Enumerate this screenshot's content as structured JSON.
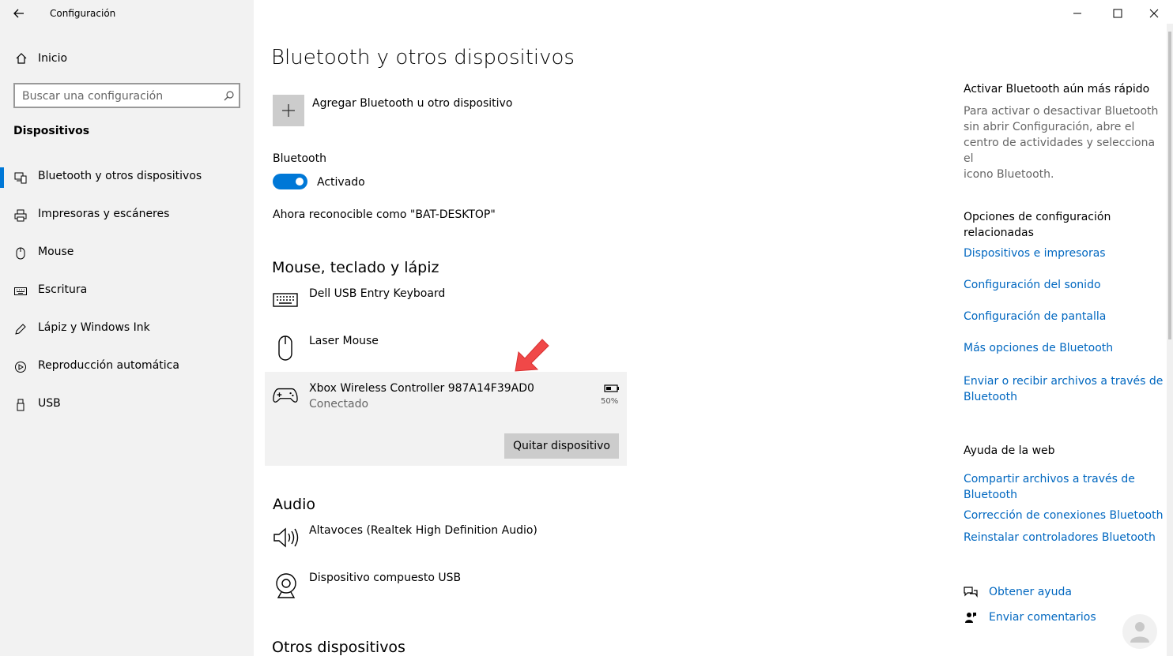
{
  "window": {
    "title": "Configuración",
    "controls": [
      "minimize-icon",
      "maximize-icon",
      "close-icon"
    ]
  },
  "sidebar": {
    "home_label": "Inicio",
    "search_placeholder": "Buscar una configuración",
    "section_title": "Dispositivos",
    "items": [
      {
        "label": "Bluetooth y otros dispositivos",
        "icon": "bluetooth-devices-icon",
        "active": true
      },
      {
        "label": "Impresoras y escáneres",
        "icon": "printer-icon",
        "active": false
      },
      {
        "label": "Mouse",
        "icon": "mouse-icon",
        "active": false
      },
      {
        "label": "Escritura",
        "icon": "keyboard-icon",
        "active": false
      },
      {
        "label": "Lápiz y Windows Ink",
        "icon": "pen-icon",
        "active": false
      },
      {
        "label": "Reproducción automática",
        "icon": "autoplay-icon",
        "active": false
      },
      {
        "label": "USB",
        "icon": "usb-icon",
        "active": false
      }
    ]
  },
  "main": {
    "page_title": "Bluetooth y otros dispositivos",
    "add_device_label": "Agregar Bluetooth u otro dispositivo",
    "bluetooth_label": "Bluetooth",
    "bluetooth_state": "Activado",
    "discoverable_text": "Ahora reconocible como \"BAT-DESKTOP\"",
    "section_input": "Mouse, teclado y lápiz",
    "input_devices": [
      {
        "name": "Dell USB Entry Keyboard",
        "icon": "keyboard-icon"
      },
      {
        "name": "Laser Mouse",
        "icon": "mouse-icon"
      }
    ],
    "xbox": {
      "name": "Xbox Wireless Controller 987A14F39AD0",
      "status": "Conectado",
      "battery": "50%",
      "remove_label": "Quitar dispositivo",
      "icon": "gamepad-icon"
    },
    "section_audio": "Audio",
    "audio_devices": [
      {
        "name": "Altavoces (Realtek High Definition Audio)",
        "icon": "speaker-icon"
      },
      {
        "name": "Dispositivo compuesto USB",
        "icon": "webcam-icon"
      }
    ],
    "section_other": "Otros dispositivos"
  },
  "right_panel": {
    "quick_title": "Activar Bluetooth aún más rápido",
    "quick_desc_lines": [
      "Para activar o desactivar Bluetooth",
      "sin abrir Configuración, abre el",
      "centro de actividades y selecciona el",
      "icono Bluetooth."
    ],
    "related_title_lines": [
      "Opciones de configuración",
      "relacionadas"
    ],
    "related_links": [
      "Dispositivos e impresoras",
      "Configuración del sonido",
      "Configuración de pantalla",
      "Más opciones de Bluetooth"
    ],
    "send_link_lines": [
      "Enviar o recibir archivos a través de",
      "Bluetooth"
    ],
    "web_help_title": "Ayuda de la web",
    "share_link_lines": [
      "Compartir archivos a través de",
      "Bluetooth"
    ],
    "web_links": [
      "Corrección de conexiones Bluetooth",
      "Reinstalar controladores Bluetooth"
    ],
    "get_help": "Obtener ayuda",
    "feedback": "Enviar comentarios"
  },
  "colors": {
    "accent": "#0078d7",
    "link": "#0067c0",
    "sidebar_bg": "#f2f2f2",
    "arrow": "#f04848"
  }
}
